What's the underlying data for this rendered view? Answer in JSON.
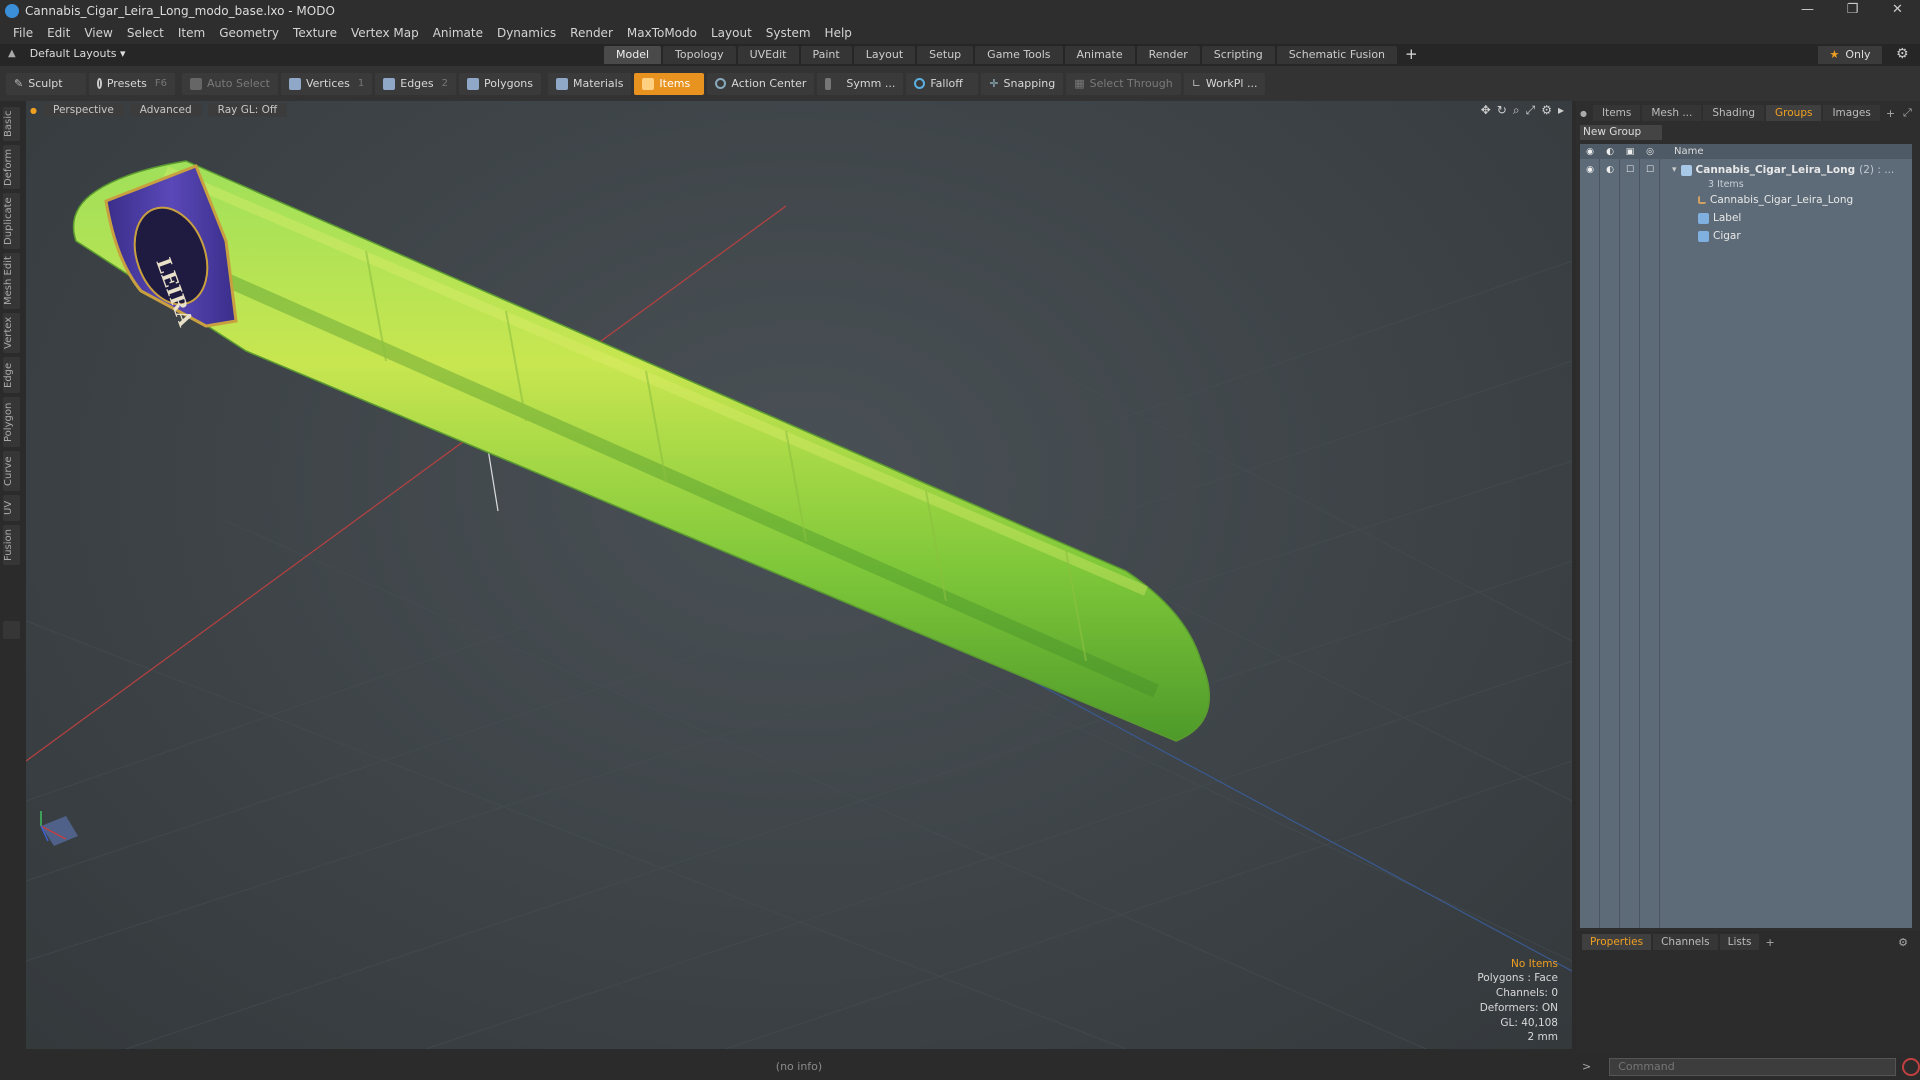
{
  "window": {
    "title": "Cannabis_Cigar_Leira_Long_modo_base.lxo - MODO",
    "controls": [
      "—",
      "❐",
      "✕"
    ]
  },
  "menu": [
    "File",
    "Edit",
    "View",
    "Select",
    "Item",
    "Geometry",
    "Texture",
    "Vertex Map",
    "Animate",
    "Dynamics",
    "Render",
    "MaxToModo",
    "Layout",
    "System",
    "Help"
  ],
  "layouts": {
    "label": "Default Layouts ▾"
  },
  "mode_tabs": [
    {
      "label": "Model",
      "active": true
    },
    {
      "label": "Topology"
    },
    {
      "label": "UVEdit"
    },
    {
      "label": "Paint"
    },
    {
      "label": "Layout"
    },
    {
      "label": "Setup"
    },
    {
      "label": "Game Tools"
    },
    {
      "label": "Animate"
    },
    {
      "label": "Render"
    },
    {
      "label": "Scripting"
    },
    {
      "label": "Schematic Fusion"
    }
  ],
  "only_label": "Only",
  "toolbar": {
    "sculpt": "Sculpt",
    "presets": "Presets",
    "presets_key": "F6",
    "auto_select": "Auto Select",
    "vertices": "Vertices",
    "vertices_key": "1",
    "edges": "Edges",
    "edges_key": "2",
    "polygons": "Polygons",
    "materials": "Materials",
    "items": "Items",
    "action_center": "Action Center",
    "symmetry": "Symm ...",
    "falloff": "Falloff",
    "snapping": "Snapping",
    "select_through": "Select Through",
    "workplane": "WorkPl ..."
  },
  "left_tabs": [
    "Basic",
    "Deform",
    "Duplicate",
    "Mesh Edit",
    "Vertex",
    "Edge",
    "Polygon",
    "Curve",
    "UV",
    "Fusion"
  ],
  "viewport": {
    "view": "Perspective",
    "shading": "Advanced",
    "raygl": "Ray GL: Off",
    "info": {
      "no_items": "No Items",
      "polygons": "Polygons : Face",
      "channels": "Channels: 0",
      "deformers": "Deformers: ON",
      "gl": "GL: 40,108",
      "unit": "2 mm"
    },
    "label_text": "LEIRA",
    "colors": {
      "cigar_light": "#c8e650",
      "cigar_dark": "#6fb82e",
      "label_band": "#4a3fa8",
      "label_trim": "#c9a040"
    }
  },
  "right_panel": {
    "tabs": [
      {
        "label": "Items"
      },
      {
        "label": "Mesh ..."
      },
      {
        "label": "Shading"
      },
      {
        "label": "Groups",
        "active": true
      },
      {
        "label": "Images"
      }
    ],
    "new_group": "New Group",
    "column_name": "Name",
    "group": {
      "name": "Cannabis_Cigar_Leira_Long",
      "count": "(2) : ...",
      "sub": "3 Items"
    },
    "children": [
      "Cannabis_Cigar_Leira_Long",
      "Label",
      "Cigar"
    ]
  },
  "props_panel": {
    "tabs": [
      {
        "label": "Properties",
        "active": true
      },
      {
        "label": "Channels"
      },
      {
        "label": "Lists"
      }
    ]
  },
  "status": {
    "info": "(no info)"
  },
  "command": {
    "placeholder": "Command"
  }
}
